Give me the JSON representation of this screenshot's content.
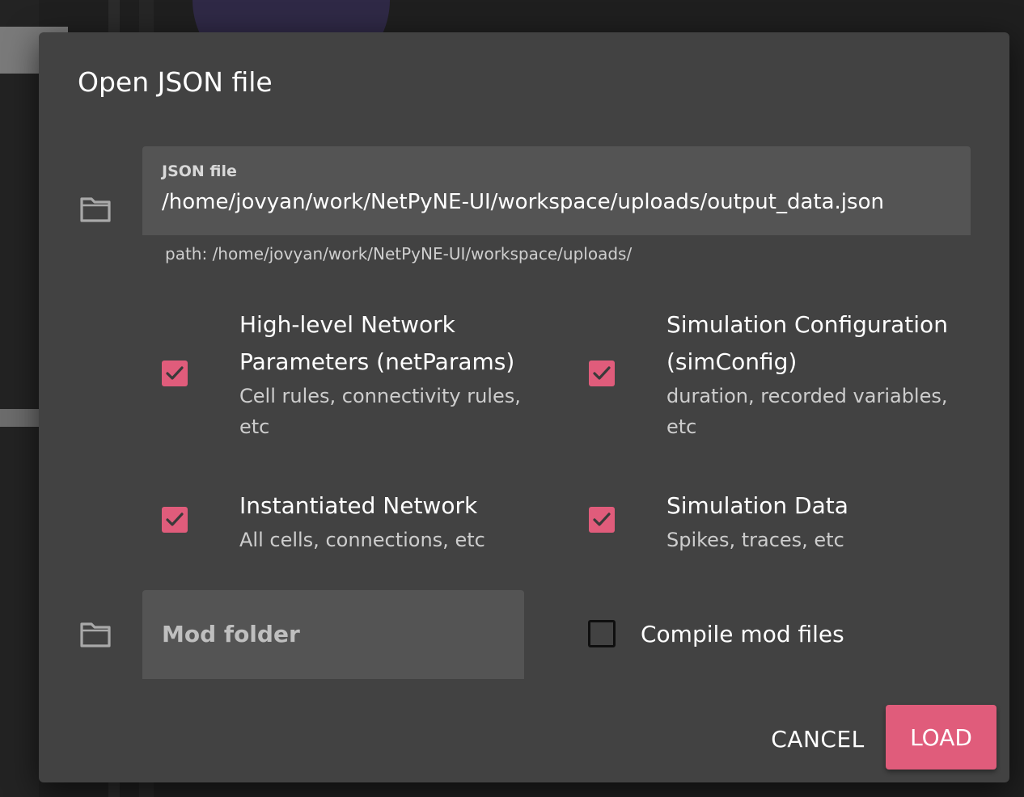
{
  "dialog": {
    "title": "Open JSON file"
  },
  "json_file": {
    "label": "JSON file",
    "value": "/home/jovyan/work/NetPyNE-UI/workspace/uploads/output_data.json",
    "helper": "path: /home/jovyan/work/NetPyNE-UI/workspace/uploads/"
  },
  "options": [
    {
      "title_line1": "High-level Network",
      "title_line2": "Parameters (netParams)",
      "desc_line1": "Cell rules, connectivity rules,",
      "desc_line2": "etc",
      "checked": true
    },
    {
      "title_line1": "Simulation Configuration",
      "title_line2": "(simConfig)",
      "desc_line1": "duration, recorded variables,",
      "desc_line2": "etc",
      "checked": true
    },
    {
      "title_line1": "Instantiated Network",
      "desc_line1": "All cells, connections, etc",
      "checked": true
    },
    {
      "title_line1": "Simulation Data",
      "desc_line1": "Spikes, traces, etc",
      "checked": true
    }
  ],
  "mod_folder": {
    "label": "Mod folder"
  },
  "compile": {
    "label": "Compile mod files",
    "checked": false
  },
  "buttons": {
    "cancel": "CANCEL",
    "load": "LOAD"
  },
  "colors": {
    "accent": "#e05c7b",
    "dialog_bg": "#424242",
    "field_bg": "#545454"
  },
  "icons": {
    "json_file": "folder-icon",
    "mod_folder": "folder-icon",
    "check": "check-icon"
  }
}
